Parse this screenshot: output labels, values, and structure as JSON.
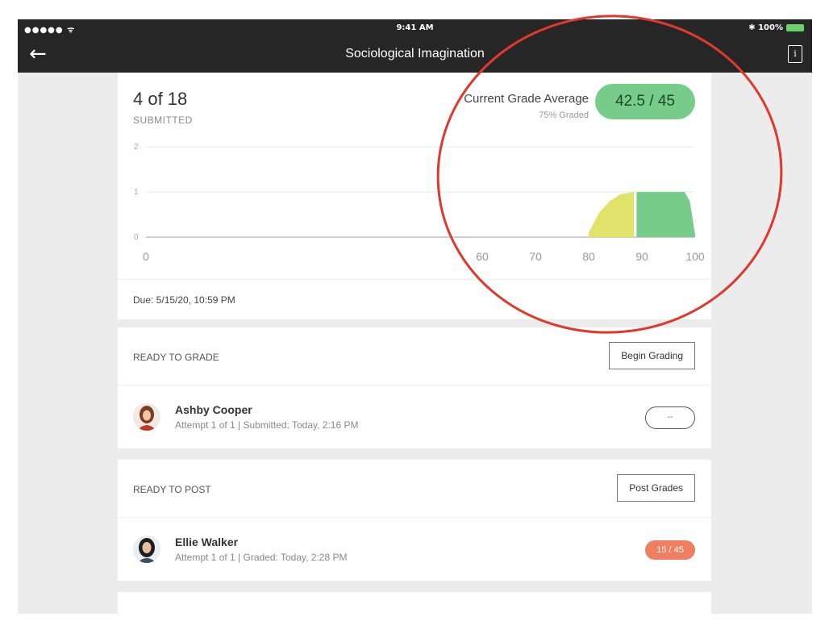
{
  "status_bar": {
    "signal": "●●●●● ᯤ",
    "time": "9:41 AM",
    "battery": "✱ 100%"
  },
  "nav": {
    "title": "Sociological Imagination",
    "back_icon": "arrow-left-icon",
    "info_icon": "info-document-icon",
    "info_glyph": "i"
  },
  "summary": {
    "count": "4 of 18",
    "count_label": "SUBMITTED",
    "avg_label": "Current Grade Average",
    "avg_sub": "75% Graded",
    "avg_value": "42.5 / 45",
    "avg_color": "#77cc8a"
  },
  "chart_data": {
    "type": "area",
    "y_ticks": [
      "0",
      "1",
      "2"
    ],
    "x_ticks": [
      "0",
      "60",
      "70",
      "80",
      "90",
      "100"
    ],
    "ylim": [
      0,
      2
    ],
    "series": [
      {
        "color": "#dfe36a",
        "points": [
          [
            80,
            0.1
          ],
          [
            82,
            0.55
          ],
          [
            84,
            0.8
          ],
          [
            86,
            0.95
          ],
          [
            88.5,
            1.0
          ],
          [
            88.5,
            0
          ]
        ]
      },
      {
        "color": "#77cc8a",
        "points": [
          [
            89,
            1.0
          ],
          [
            98,
            1.0
          ],
          [
            99,
            0.8
          ],
          [
            100,
            0.05
          ],
          [
            100,
            0
          ],
          [
            89,
            0
          ]
        ]
      }
    ]
  },
  "due": "Due: 5/15/20, 10:59 PM",
  "ready_to_grade": {
    "label": "READY TO GRADE",
    "button": "Begin Grading",
    "student": {
      "name": "Ashby Cooper",
      "meta": "Attempt 1 of 1 | Submitted: Today, 2:16 PM",
      "grade": "--"
    }
  },
  "ready_to_post": {
    "label": "READY TO POST",
    "button": "Post Grades",
    "student": {
      "name": "Ellie Walker",
      "meta": "Attempt 1 of 1 | Graded: Today, 2:28 PM",
      "grade": "15 / 45",
      "grade_color": "#f07e60"
    }
  },
  "annotation_color": "#e0392b"
}
